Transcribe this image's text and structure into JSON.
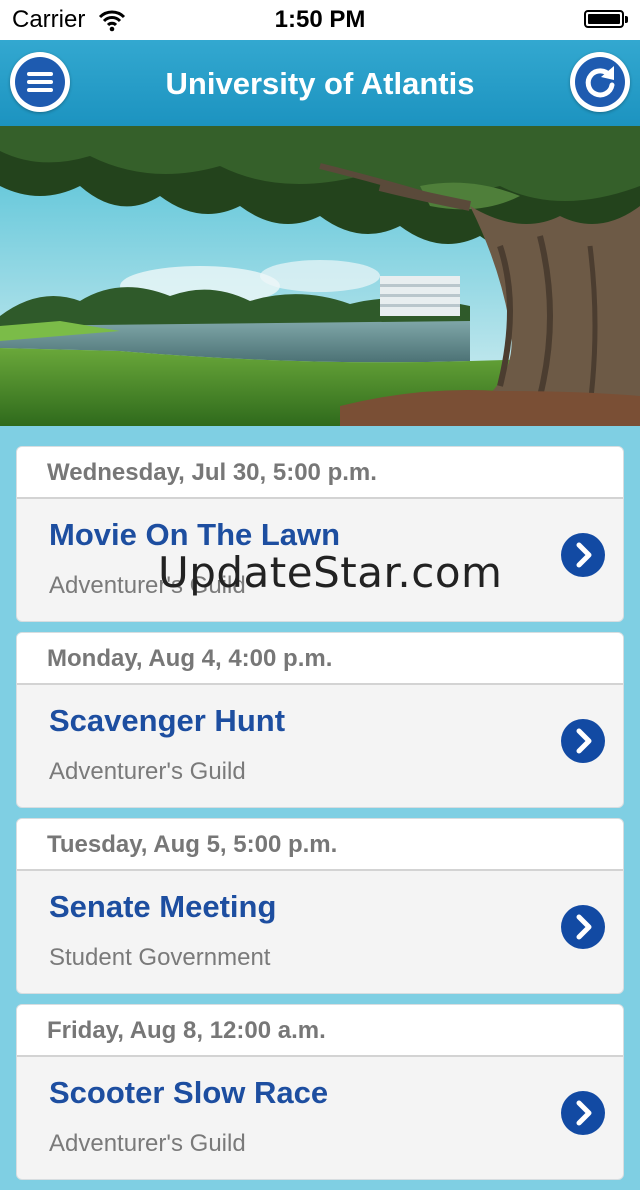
{
  "status_bar": {
    "carrier": "Carrier",
    "time": "1:50 PM"
  },
  "nav": {
    "title": "University of Atlantis",
    "menu_icon": "menu-icon",
    "refresh_icon": "refresh-icon",
    "accent_color": "#1c93c0",
    "button_color": "#1e5bb0"
  },
  "events": [
    {
      "date": "Wednesday, Jul 30, 5:00 p.m.",
      "title": "Movie On The Lawn",
      "org": "Adventurer's Guild"
    },
    {
      "date": "Monday, Aug 4, 4:00 p.m.",
      "title": "Scavenger Hunt",
      "org": "Adventurer's Guild"
    },
    {
      "date": "Tuesday, Aug 5, 5:00 p.m.",
      "title": "Senate Meeting",
      "org": "Student Government"
    },
    {
      "date": "Friday, Aug 8, 12:00 a.m.",
      "title": "Scooter Slow Race",
      "org": "Adventurer's Guild"
    }
  ],
  "watermark": "UpdateStar.com"
}
